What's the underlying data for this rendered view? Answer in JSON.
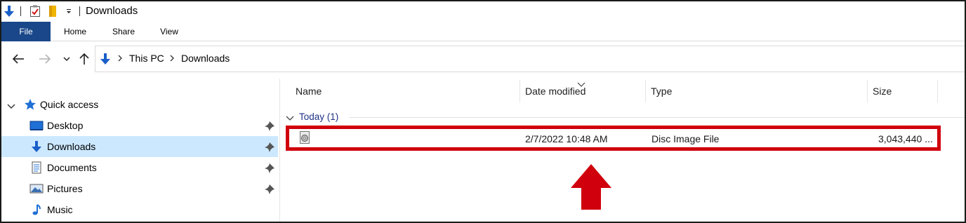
{
  "window": {
    "title": "Downloads",
    "quick_access_toolbar": [
      {
        "icon": "download-arrow-icon"
      },
      {
        "icon": "properties-checklist-icon"
      },
      {
        "icon": "new-folder-icon"
      },
      {
        "icon": "customize-dropdown-icon"
      }
    ]
  },
  "ribbon": {
    "tabs": [
      "File",
      "Home",
      "Share",
      "View"
    ]
  },
  "address_bar": {
    "nav_buttons": [
      "back-arrow-icon",
      "forward-arrow-icon",
      "recent-dropdown-icon",
      "up-arrow-icon"
    ],
    "breadcrumb": [
      "This PC",
      "Downloads"
    ]
  },
  "nav_pane": {
    "quick_access_label": "Quick access",
    "items": [
      {
        "label": "Desktop",
        "icon": "desktop-icon",
        "pinned": true,
        "selected": false
      },
      {
        "label": "Downloads",
        "icon": "downloads-icon",
        "pinned": true,
        "selected": true
      },
      {
        "label": "Documents",
        "icon": "documents-icon",
        "pinned": true,
        "selected": false
      },
      {
        "label": "Pictures",
        "icon": "pictures-icon",
        "pinned": true,
        "selected": false
      },
      {
        "label": "Music",
        "icon": "music-icon",
        "pinned": false,
        "selected": false
      }
    ]
  },
  "file_list": {
    "columns": [
      "Name",
      "Date modified",
      "Type",
      "Size"
    ],
    "sorted_by": "Date modified",
    "group": {
      "label": "Today (1)"
    },
    "rows": [
      {
        "name": "",
        "date_modified": "2/7/2022 10:48 AM",
        "type": "Disc Image File",
        "size": "3,043,440 ...",
        "icon": "disc-image-file-icon"
      }
    ]
  },
  "annotations": {
    "highlight_color": "#d0000c",
    "arrow_color": "#d0000c"
  }
}
